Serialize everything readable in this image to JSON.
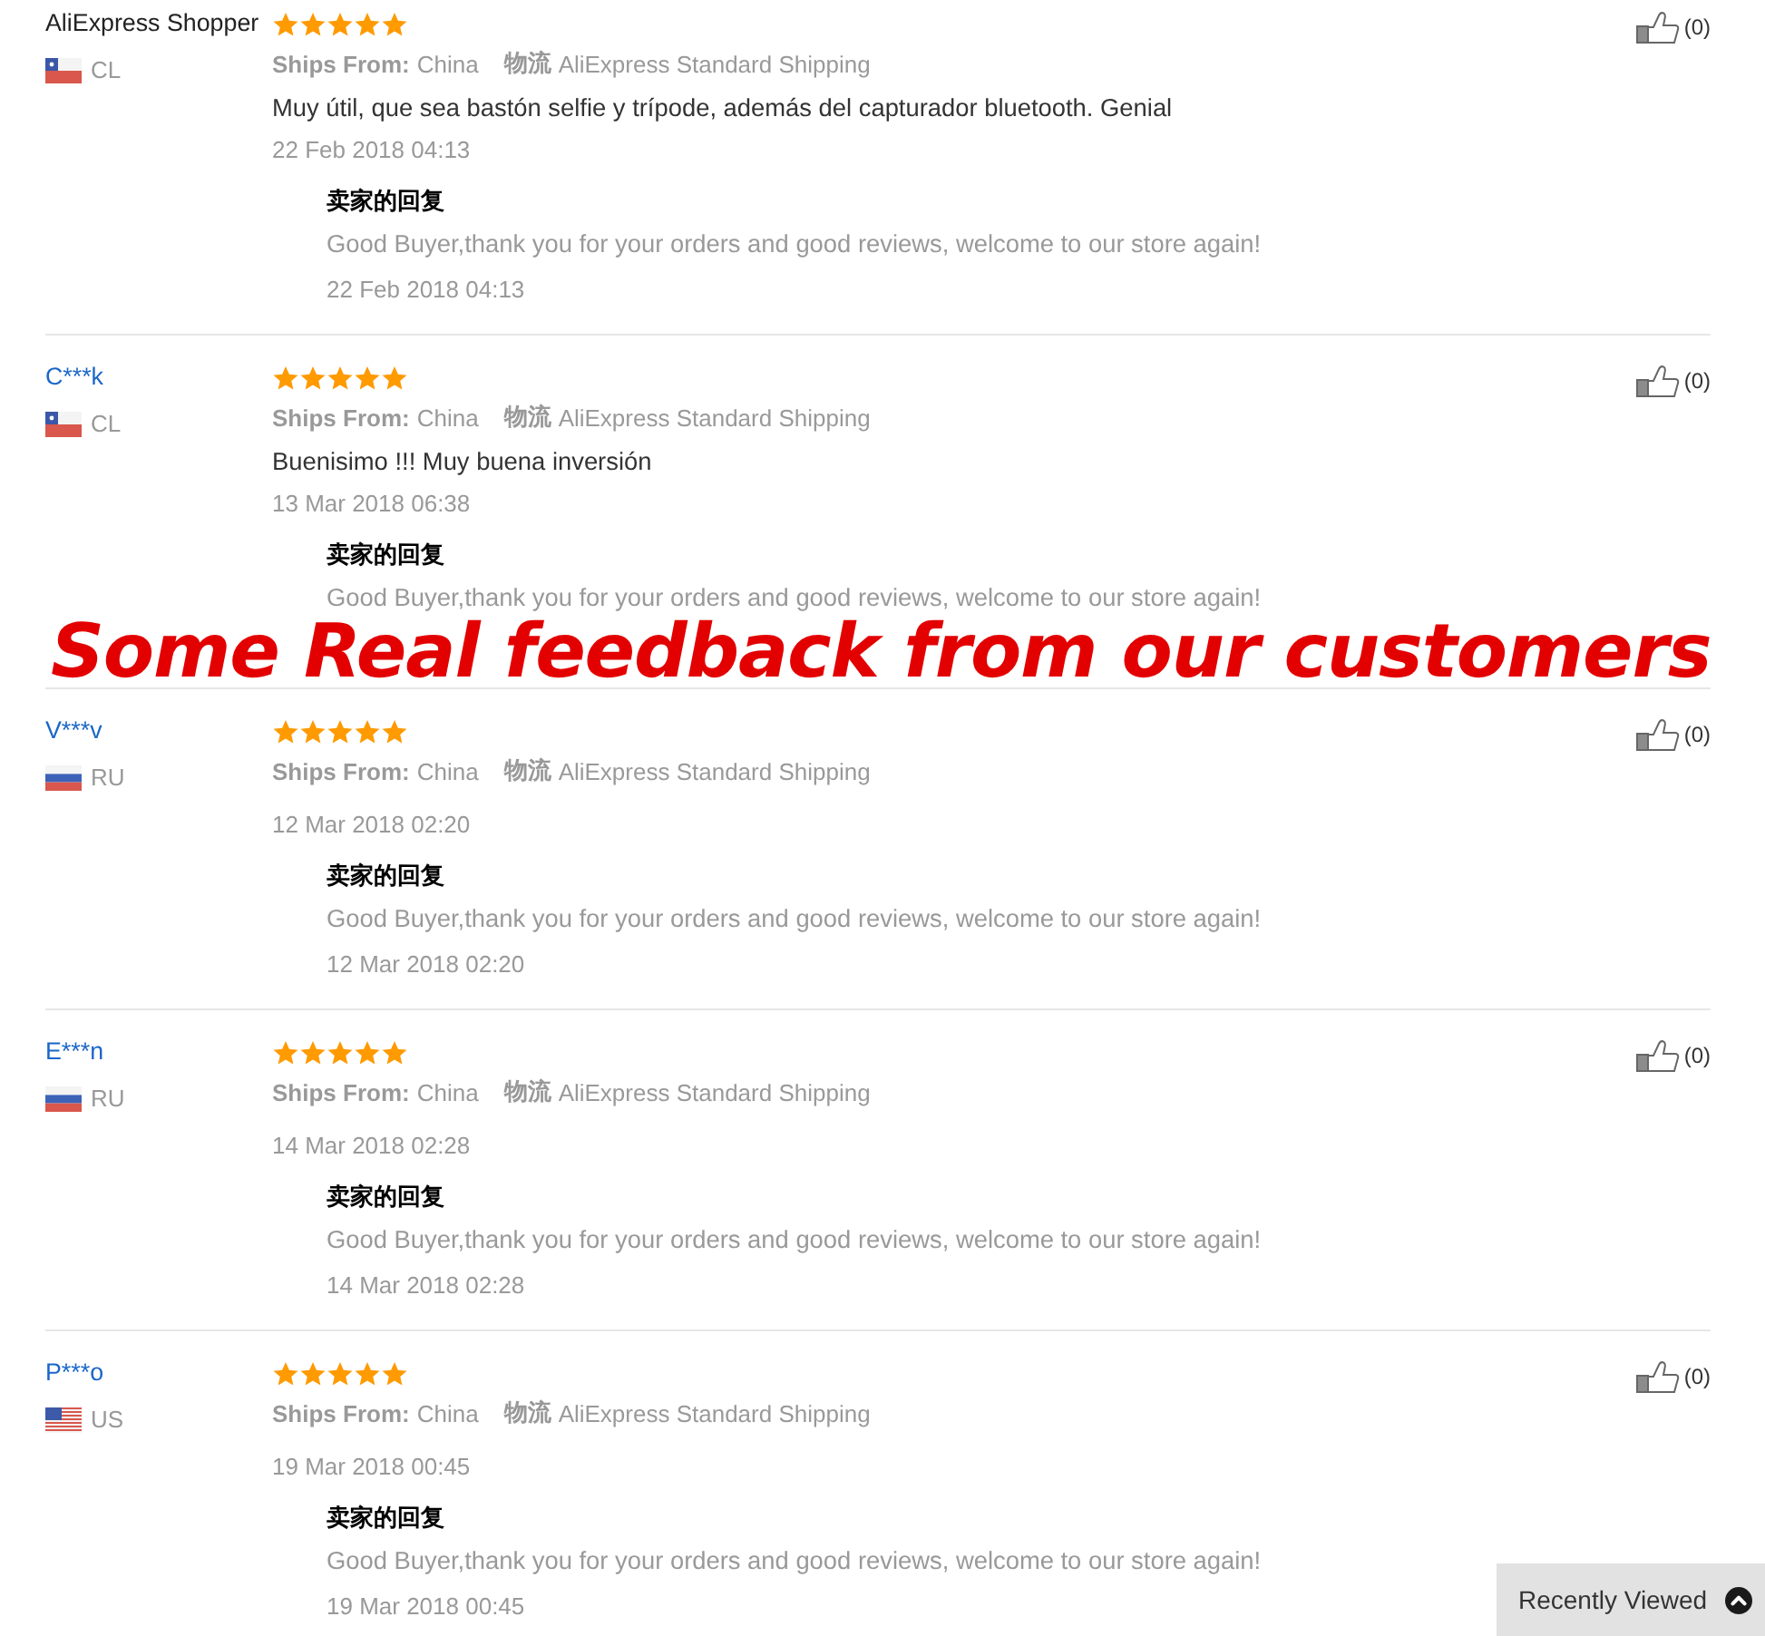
{
  "reviews": [
    {
      "buyer": {
        "name": "AliExpress Shopper",
        "linked": false
      },
      "country": {
        "code": "CL",
        "kind": "chile"
      },
      "stars": 5,
      "ships_from": {
        "label": "Ships From:",
        "value": "China"
      },
      "logistics": {
        "label": "物流",
        "value": "AliExpress Standard Shipping"
      },
      "text": "Muy útil, que sea bastón selfie y trípode, además del capturador bluetooth. Genial",
      "date": "22 Feb 2018 04:13",
      "seller_reply": {
        "title": "卖家的回复",
        "text": "Good Buyer,thank you for your orders and good reviews, welcome to our store again!",
        "date": "22 Feb 2018 04:13"
      },
      "likes": "(0)"
    },
    {
      "buyer": {
        "name": "C***k",
        "linked": true
      },
      "country": {
        "code": "CL",
        "kind": "chile"
      },
      "stars": 5,
      "ships_from": {
        "label": "Ships From:",
        "value": "China"
      },
      "logistics": {
        "label": "物流",
        "value": "AliExpress Standard Shipping"
      },
      "text": "Buenisimo !!! Muy buena inversión",
      "date": "13 Mar 2018 06:38",
      "seller_reply": {
        "title": "卖家的回复",
        "text": "Good Buyer,thank you for your orders and good reviews, welcome to our store again!"
      },
      "likes": "(0)"
    },
    {
      "buyer": {
        "name": "V***v",
        "linked": true
      },
      "country": {
        "code": "RU",
        "kind": "russia"
      },
      "stars": 5,
      "ships_from": {
        "label": "Ships From:",
        "value": "China"
      },
      "logistics": {
        "label": "物流",
        "value": "AliExpress Standard Shipping"
      },
      "date": "12 Mar 2018 02:20",
      "seller_reply": {
        "title": "卖家的回复",
        "text": "Good Buyer,thank you for your orders and good reviews, welcome to our store again!",
        "date": "12 Mar 2018 02:20"
      },
      "likes": "(0)"
    },
    {
      "buyer": {
        "name": "E***n",
        "linked": true
      },
      "country": {
        "code": "RU",
        "kind": "russia"
      },
      "stars": 5,
      "ships_from": {
        "label": "Ships From:",
        "value": "China"
      },
      "logistics": {
        "label": "物流",
        "value": "AliExpress Standard Shipping"
      },
      "date": "14 Mar 2018 02:28",
      "seller_reply": {
        "title": "卖家的回复",
        "text": "Good Buyer,thank you for your orders and good reviews, welcome to our store again!",
        "date": "14 Mar 2018 02:28"
      },
      "likes": "(0)"
    },
    {
      "buyer": {
        "name": "P***o",
        "linked": true
      },
      "country": {
        "code": "US",
        "kind": "usa"
      },
      "stars": 5,
      "ships_from": {
        "label": "Ships From:",
        "value": "China"
      },
      "logistics": {
        "label": "物流",
        "value": "AliExpress Standard Shipping"
      },
      "date": "19 Mar 2018 00:45",
      "seller_reply": {
        "title": "卖家的回复",
        "text": "Good Buyer,thank you for your orders and good reviews, welcome to our store again!",
        "date": "19 Mar 2018 00:45"
      },
      "likes": "(0)"
    }
  ],
  "overlay_caption": "Some Real feedback from our customers",
  "recently_viewed": {
    "label": "Recently Viewed"
  }
}
